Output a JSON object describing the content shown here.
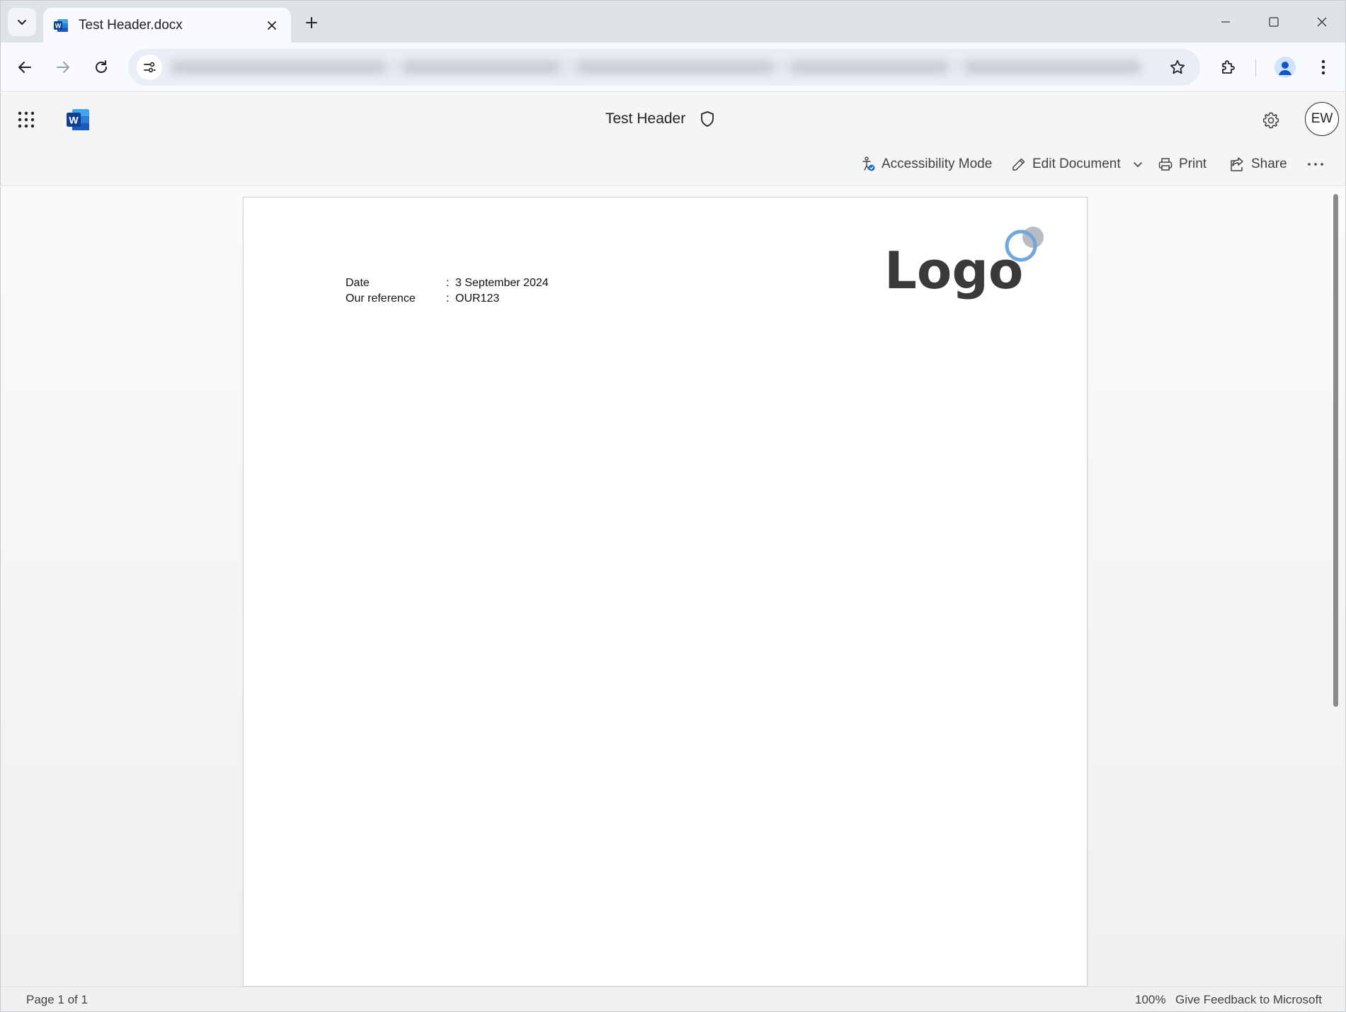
{
  "browser": {
    "tab_title": "Test Header.docx",
    "omnibox_url": ""
  },
  "app": {
    "doc_title": "Test Header",
    "avatar_initials": "EW",
    "commands": {
      "accessibility": "Accessibility Mode",
      "edit": "Edit Document",
      "print": "Print",
      "share": "Share"
    }
  },
  "document": {
    "fields": [
      {
        "label": "Date",
        "value": "3 September 2024"
      },
      {
        "label": "Our reference",
        "value": "OUR123"
      }
    ],
    "colon": ":",
    "logo_text": "Logo"
  },
  "status": {
    "page": "Page 1 of 1",
    "zoom": "100%",
    "feedback": "Give Feedback to Microsoft"
  },
  "colors": {
    "word_blue": "#185abd",
    "logo_dark": "#3a3a3c",
    "logo_ring": "#6ea8dc",
    "logo_dot": "#b9bcc2"
  }
}
